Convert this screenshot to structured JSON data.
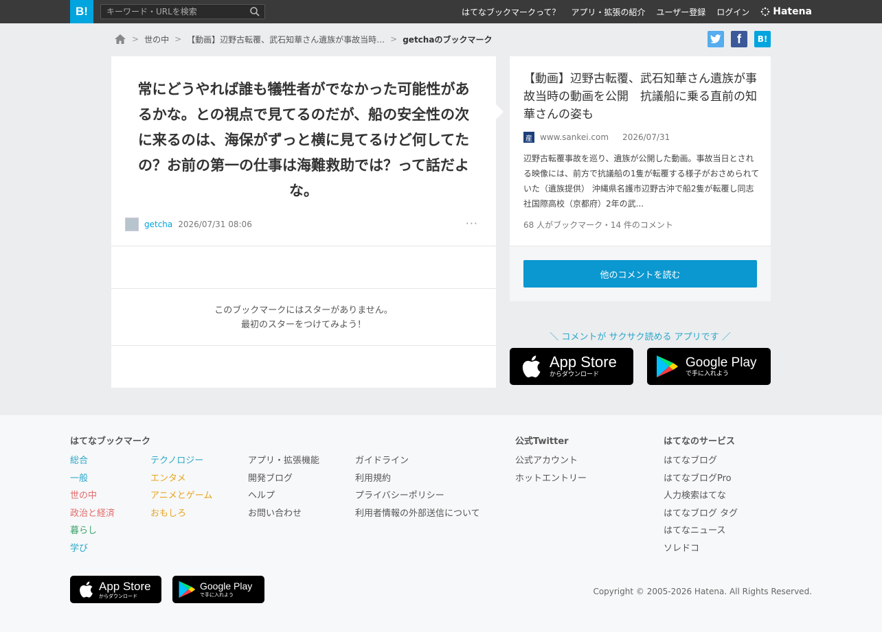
{
  "header": {
    "logo": "B!",
    "search_placeholder": "キーワード・URLを検索",
    "nav": [
      "はてなブックマークって？",
      "アプリ・拡張の紹介",
      "ユーザー登録",
      "ログイン"
    ],
    "brand": "Hatena"
  },
  "breadcrumb": {
    "items": [
      "世の中",
      "【動画】辺野古転覆、武石知華さん遺族が事故当時…",
      "getchaのブックマーク"
    ]
  },
  "share": {
    "hatena_label": "B!",
    "facebook_label": "f"
  },
  "bookmark": {
    "comment": "常にどうやれば誰も犠牲者がでなかった可能性があるかな。との視点で見てるのだが、船の安全性の次に来るのは、海保がずっと横に見てるけど何してたの？お前の第一の仕事は海難救助では？って話だよな。",
    "user": "getcha",
    "timestamp": "2026/07/31 08:06",
    "more": "···",
    "star_note_1": "このブックマークにはスターがありません。",
    "star_note_2": "最初のスターをつけてみよう！"
  },
  "article": {
    "title": "【動画】辺野古転覆、武石知華さん遺族が事故当時の動画を公開　抗議船に乗る直前の知華さんの姿も",
    "favicon": "産",
    "domain": "www.sankei.com",
    "date": "2026/07/31",
    "summary": "辺野古転覆事故を巡り、遺族が公開した動画。事故当日とされる映像には、前方で抗議船の1隻が転覆する様子がおさめられていた（遺族提供） 沖縄県名護市辺野古沖で船2隻が転覆し同志社国際高校（京都府）2年の武...",
    "counts": "68 人がブックマーク・14 件のコメント",
    "read_more": "他のコメントを読む"
  },
  "app_promo": {
    "tagline": "＼ コメントが サクサク読める アプリです ／",
    "appstore_title": "App Store",
    "appstore_sub": "からダウンロード",
    "gplay_title": "Google Play",
    "gplay_sub": "で手に入れよう"
  },
  "footer": {
    "col1_head": "はてなブックマーク",
    "cat_a": [
      "総合",
      "一般",
      "世の中",
      "政治と経済",
      "暮らし",
      "学び"
    ],
    "cat_b": [
      "テクノロジー",
      "エンタメ",
      "アニメとゲーム",
      "おもしろ"
    ],
    "links_a": [
      "アプリ・拡張機能",
      "開発ブログ",
      "ヘルプ",
      "お問い合わせ"
    ],
    "links_b": [
      "ガイドライン",
      "利用規約",
      "プライバシーポリシー",
      "利用者情報の外部送信について"
    ],
    "twitter_head": "公式Twitter",
    "twitter_links": [
      "公式アカウント",
      "ホットエントリー"
    ],
    "services_head": "はてなのサービス",
    "services": [
      "はてなブログ",
      "はてなブログPro",
      "人力検索はてな",
      "はてなブログ タグ",
      "はてなニュース",
      "ソレドコ"
    ],
    "copyright": "Copyright © 2005-2026 Hatena. All Rights Reserved."
  },
  "colors": {
    "accent": "#00a4de",
    "button": "#0b97cf",
    "header_bg": "#3a3a3a",
    "twitter": "#55acee",
    "facebook": "#3b5998"
  }
}
